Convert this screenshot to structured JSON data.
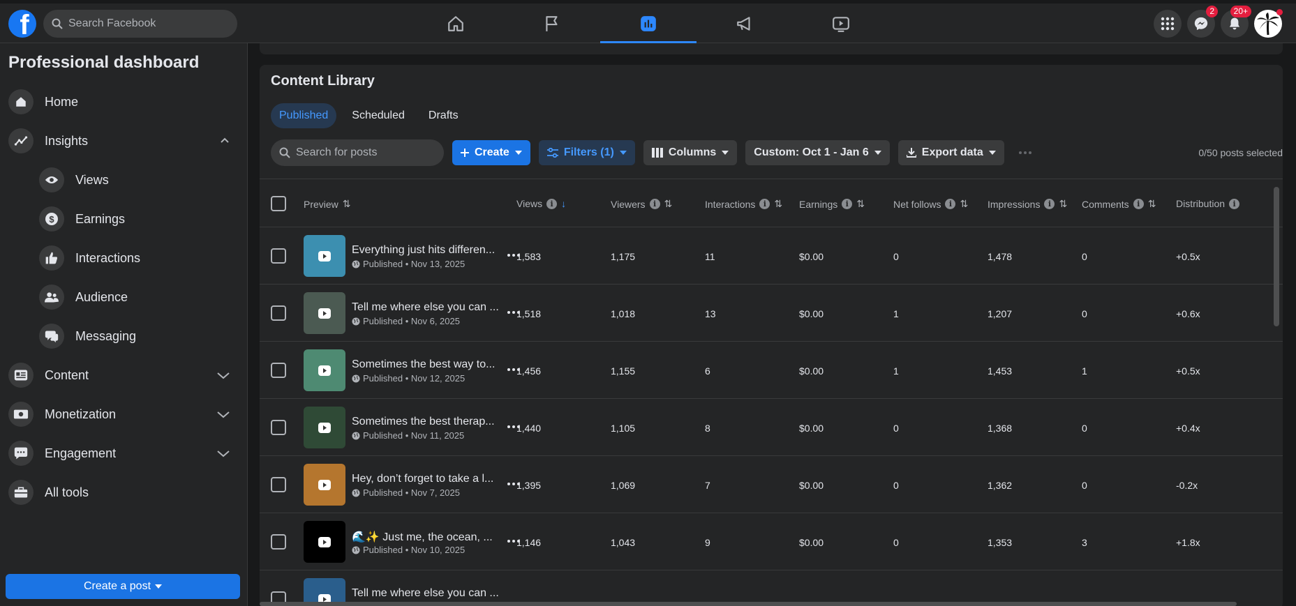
{
  "topbar": {
    "logo": "f",
    "search_placeholder": "Search Facebook",
    "nav_icons": [
      "home-icon",
      "flag-icon",
      "insights-icon",
      "megaphone-icon",
      "video-icon"
    ],
    "messenger_badge": "2",
    "notifications_badge": "20+"
  },
  "sidebar": {
    "title": "Professional dashboard",
    "items": {
      "home": "Home",
      "insights": "Insights",
      "views": "Views",
      "earnings": "Earnings",
      "interactions": "Interactions",
      "audience": "Audience",
      "messaging": "Messaging",
      "content": "Content",
      "monetization": "Monetization",
      "engagement": "Engagement",
      "all_tools": "All tools"
    },
    "create_post": "Create a post"
  },
  "library": {
    "title": "Content Library",
    "tabs": [
      "Published",
      "Scheduled",
      "Drafts"
    ],
    "search_placeholder": "Search for posts",
    "create": "Create",
    "filters": "Filters (1)",
    "columns": "Columns",
    "date_range": "Custom: Oct 1 - Jan 6",
    "export": "Export data",
    "selected_count": "0/50",
    "selected_label": "posts selected"
  },
  "table": {
    "headers": {
      "preview": "Preview",
      "views": "Views",
      "viewers": "Viewers",
      "interactions": "Interactions",
      "earnings": "Earnings",
      "net_follows": "Net follows",
      "impressions": "Impressions",
      "comments": "Comments",
      "distribution": "Distribution"
    },
    "rows": [
      {
        "title": "Everything just hits differen...",
        "meta": "Published • Nov 13, 2025",
        "views": "1,583",
        "viewers": "1,175",
        "interactions": "11",
        "earnings": "$0.00",
        "net_follows": "0",
        "impressions": "1,478",
        "comments": "0",
        "distribution": "+0.5x",
        "thumb": "#3c8fb0"
      },
      {
        "title": "Tell me where else you can ...",
        "meta": "Published • Nov 6, 2025",
        "views": "1,518",
        "viewers": "1,018",
        "interactions": "13",
        "earnings": "$0.00",
        "net_follows": "1",
        "impressions": "1,207",
        "comments": "0",
        "distribution": "+0.6x",
        "thumb": "#4b5a52"
      },
      {
        "title": "Sometimes the best way to...",
        "meta": "Published • Nov 12, 2025",
        "views": "1,456",
        "viewers": "1,155",
        "interactions": "6",
        "earnings": "$0.00",
        "net_follows": "1",
        "impressions": "1,453",
        "comments": "1",
        "distribution": "+0.5x",
        "thumb": "#4e8a72"
      },
      {
        "title": "Sometimes the best therap...",
        "meta": "Published • Nov 11, 2025",
        "views": "1,440",
        "viewers": "1,105",
        "interactions": "8",
        "earnings": "$0.00",
        "net_follows": "0",
        "impressions": "1,368",
        "comments": "0",
        "distribution": "+0.4x",
        "thumb": "#2f4a36"
      },
      {
        "title": "Hey, don’t forget to take a l...",
        "meta": "Published • Nov 7, 2025",
        "views": "1,395",
        "viewers": "1,069",
        "interactions": "7",
        "earnings": "$0.00",
        "net_follows": "0",
        "impressions": "1,362",
        "comments": "0",
        "distribution": "-0.2x",
        "thumb": "#b5762e"
      },
      {
        "title": "🌊✨ Just me, the ocean, ...",
        "meta": "Published • Nov 10, 2025",
        "views": "1,146",
        "viewers": "1,043",
        "interactions": "9",
        "earnings": "$0.00",
        "net_follows": "0",
        "impressions": "1,353",
        "comments": "3",
        "distribution": "+1.8x",
        "thumb": "#000000"
      },
      {
        "title": "Tell me where else you can ...",
        "meta": "",
        "views": "",
        "viewers": "",
        "interactions": "",
        "earnings": "",
        "net_follows": "",
        "impressions": "",
        "comments": "",
        "distribution": "",
        "thumb": "#2a5e8c"
      }
    ]
  }
}
